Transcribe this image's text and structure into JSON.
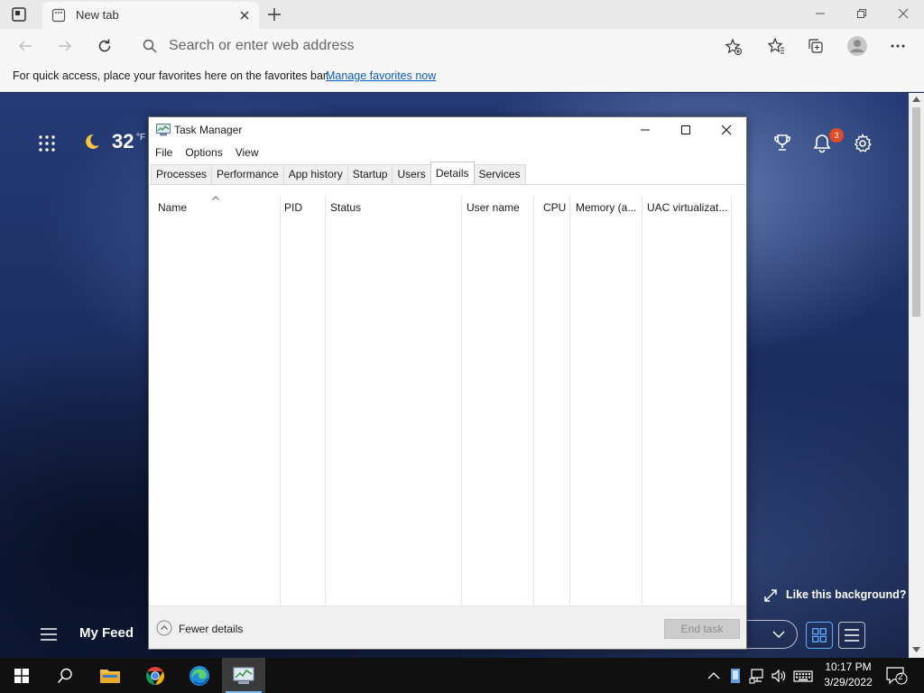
{
  "browser": {
    "tab": {
      "title": "New tab"
    },
    "address": {
      "placeholder": "Search or enter web address"
    },
    "favorites_bar": {
      "message": "For quick access, place your favorites here on the favorites bar.",
      "link": "Manage favorites now"
    }
  },
  "new_tab_page": {
    "weather": {
      "temp": "32",
      "unit": "°F"
    },
    "notifications_badge": "3",
    "like_background": "Like this background?",
    "feed_label": "My Feed"
  },
  "task_manager": {
    "title": "Task Manager",
    "menu": [
      "File",
      "Options",
      "View"
    ],
    "tabs": [
      {
        "label": "Processes",
        "active": false
      },
      {
        "label": "Performance",
        "active": false
      },
      {
        "label": "App history",
        "active": false
      },
      {
        "label": "Startup",
        "active": false
      },
      {
        "label": "Users",
        "active": false
      },
      {
        "label": "Details",
        "active": true
      },
      {
        "label": "Services",
        "active": false
      }
    ],
    "columns": [
      "Name",
      "PID",
      "Status",
      "User name",
      "CPU",
      "Memory (a...",
      "UAC virtualizat..."
    ],
    "rows": [],
    "footer": {
      "fewer_details": "Fewer details",
      "end_task": "End task"
    }
  },
  "taskbar": {
    "time": "10:17 PM",
    "date": "3/29/2022",
    "notification_count": "2"
  },
  "colors": {
    "accent": "#0a5fbd",
    "taskbar": "#101010",
    "badge": "#e04a25"
  }
}
